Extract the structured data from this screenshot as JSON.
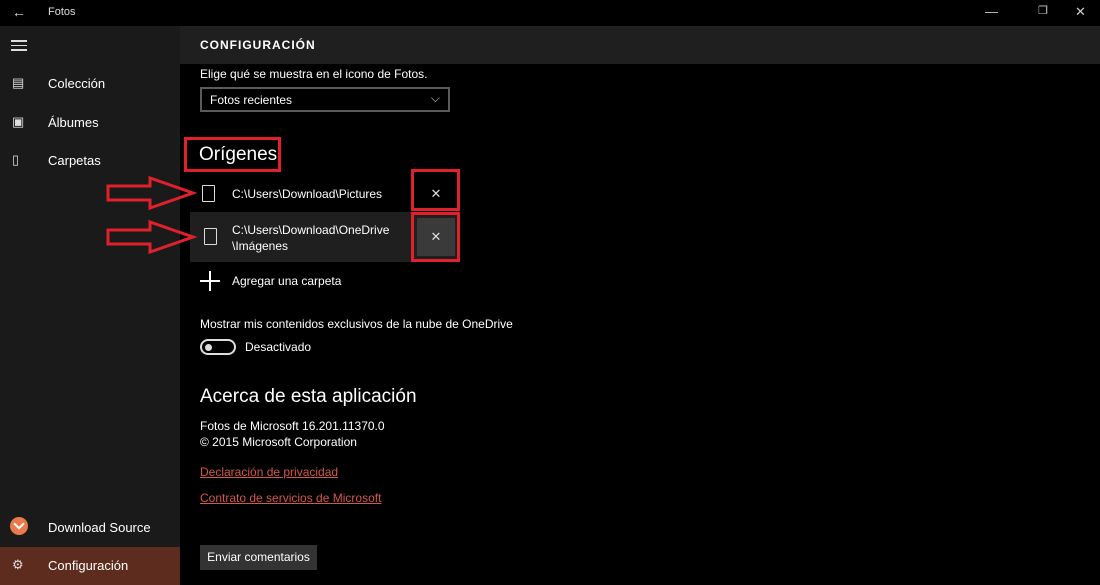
{
  "titlebar": {
    "title": "Fotos",
    "back_icon": "back-arrow-icon",
    "minimize": "—",
    "restore": "❐",
    "close": "✕"
  },
  "sidebar": {
    "items": [
      {
        "label": "Colección",
        "icon": "collection-icon"
      },
      {
        "label": "Álbumes",
        "icon": "album-icon"
      },
      {
        "label": "Carpetas",
        "icon": "folder-icon"
      }
    ],
    "bottom": [
      {
        "label": "Download Source",
        "icon": "download-source-logo"
      },
      {
        "label": "Configuración",
        "icon": "gear-icon",
        "active": true
      }
    ]
  },
  "header": {
    "title": "CONFIGURACIÓN"
  },
  "settings": {
    "tile_label": "Elige qué se muestra en el icono de Fotos.",
    "tile_select_value": "Fotos recientes",
    "sources_heading": "Orígenes",
    "sources": [
      {
        "path_line1": "C:\\Users\\Download\\Pictures",
        "path_line2": ""
      },
      {
        "path_line1": "C:\\Users\\Download\\OneDrive",
        "path_line2": "\\Imágenes"
      }
    ],
    "add_folder": "Agregar una carpeta",
    "onedrive_label": "Mostrar mis contenidos exclusivos de la nube de OneDrive",
    "onedrive_toggle_state": "Desactivado",
    "about_heading": "Acerca de esta aplicación",
    "version": "Fotos de Microsoft 16.201.11370.0",
    "copyright": "© 2015 Microsoft Corporation",
    "privacy_link": "Declaración de privacidad",
    "services_link": "Contrato de servicios de Microsoft",
    "feedback_button": "Enviar comentarios",
    "remove_glyph": "✕"
  },
  "colors": {
    "accent": "#5e2c1f",
    "link": "#d2584a",
    "annotation": "#e0202b"
  }
}
